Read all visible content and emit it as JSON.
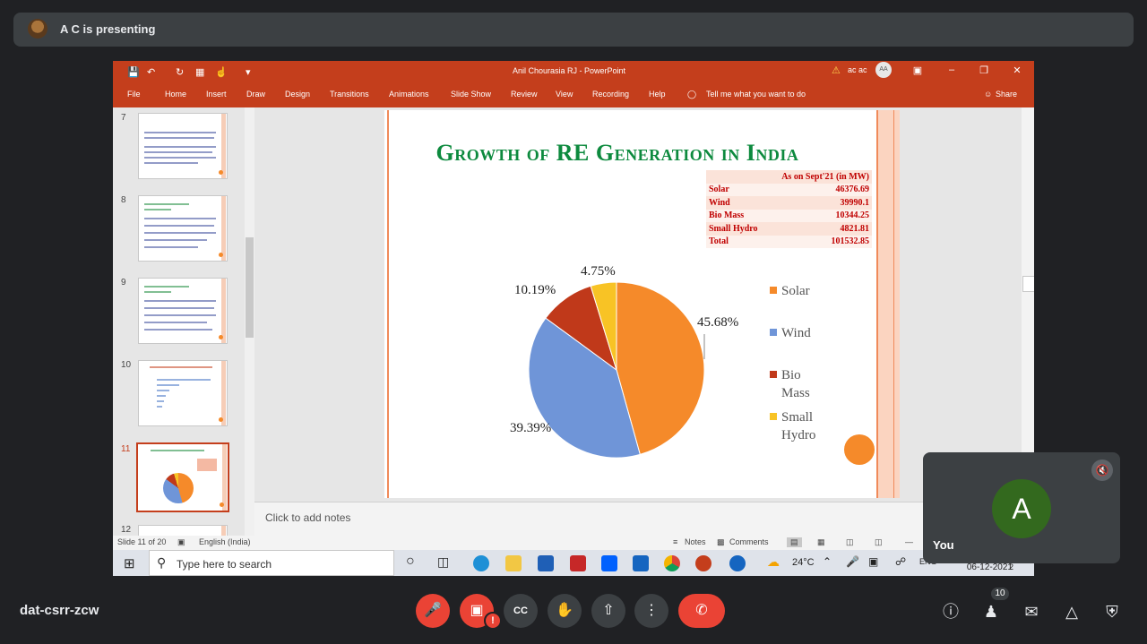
{
  "meeting": {
    "presenter_text": "A C is presenting",
    "code": "dat-csrr-zcw",
    "participant_count": "10",
    "self_label": "You",
    "self_initial": "A"
  },
  "powerpoint": {
    "doc_title": "Anil Chourasia RJ  -  PowerPoint",
    "user_name": "ac ac",
    "user_initials": "AA",
    "ribbon_tabs": [
      "File",
      "Home",
      "Insert",
      "Draw",
      "Design",
      "Transitions",
      "Animations",
      "Slide Show",
      "Review",
      "View",
      "Recording",
      "Help"
    ],
    "tell_me": "Tell me what you want to do",
    "share": "Share",
    "thumb_numbers": [
      "7",
      "8",
      "9",
      "10",
      "11",
      "12"
    ],
    "notes_placeholder": "Click to add notes",
    "status": {
      "slide_of": "Slide 11 of 20",
      "language": "English (India)",
      "notes": "Notes",
      "comments": "Comments"
    }
  },
  "slide": {
    "title": "Growth of RE Generation in India",
    "table": {
      "header": "As on Sept'21 (in MW)",
      "rows": [
        {
          "label": "Solar",
          "value": "46376.69"
        },
        {
          "label": "Wind",
          "value": "39990.1"
        },
        {
          "label": "Bio Mass",
          "value": "10344.25"
        },
        {
          "label": "Small Hydro",
          "value": "4821.81"
        },
        {
          "label": "Total",
          "value": "101532.85"
        }
      ]
    },
    "legend": {
      "solar": "Solar",
      "wind": "Wind",
      "bio_1": "Bio",
      "bio_2": "Mass",
      "hydro_1": "Small",
      "hydro_2": "Hydro"
    }
  },
  "chart_data": {
    "type": "pie",
    "title": "",
    "categories": [
      "Solar",
      "Wind",
      "Bio Mass",
      "Small Hydro"
    ],
    "values": [
      45.68,
      39.39,
      10.19,
      4.75
    ],
    "labels": [
      "45.68%",
      "39.39%",
      "10.19%",
      "4.75%"
    ],
    "colors": [
      "#f58a2a",
      "#6f95d8",
      "#c0391a",
      "#f8c325"
    ],
    "legend_position": "right"
  },
  "taskbar": {
    "search_placeholder": "Type here to search",
    "temperature": "24°C",
    "lang": "ENG",
    "date": "06-12-2021",
    "notif_count": "2"
  }
}
